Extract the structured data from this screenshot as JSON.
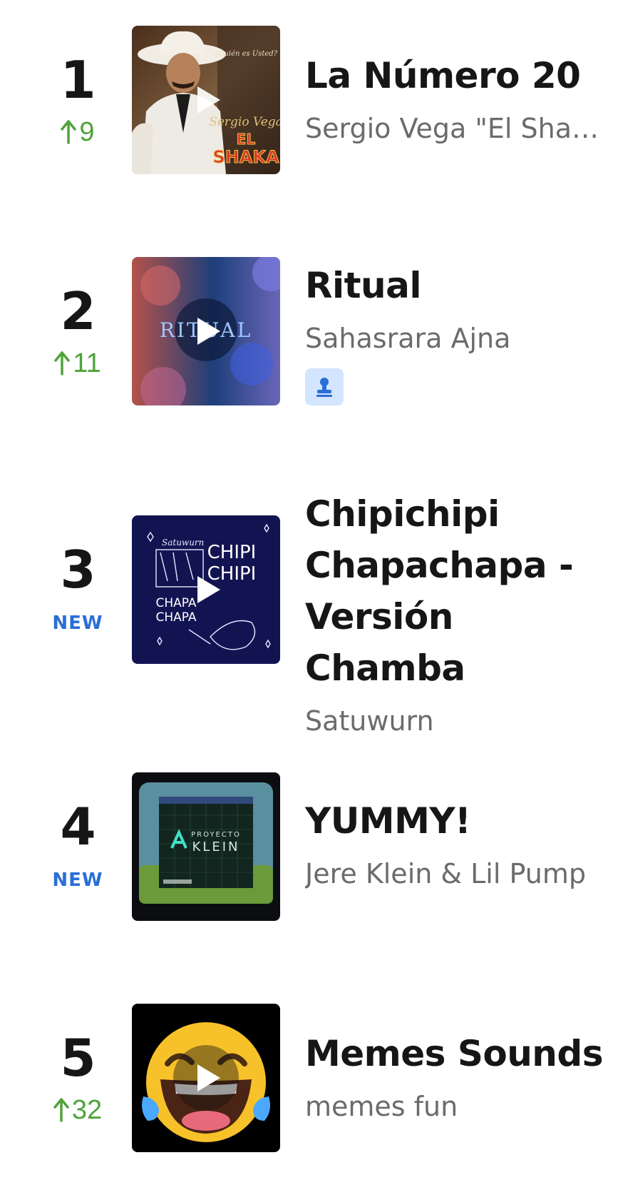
{
  "chart": {
    "entries": [
      {
        "rank": "1",
        "change": "9",
        "change_type": "up",
        "title": "La Número 20",
        "artist": "Sergio Vega \"El Shaka\"",
        "cover_icon": "album-cover-cowboy"
      },
      {
        "rank": "2",
        "change": "11",
        "change_type": "up",
        "title": "Ritual",
        "artist": "Sahasrara Ajna",
        "cover_icon": "album-cover-ritual",
        "badge_icon": "stamp-icon"
      },
      {
        "rank": "3",
        "change": "NEW",
        "change_type": "new",
        "title": "Chipichipi Chapachapa - Versión Chamba",
        "artist": "Satuwurn",
        "cover_icon": "album-cover-chipichipi"
      },
      {
        "rank": "4",
        "change": "NEW",
        "change_type": "new",
        "title": "YUMMY!",
        "artist": "Jere Klein & Lil Pump",
        "cover_icon": "album-cover-proyecto-klein"
      },
      {
        "rank": "5",
        "change": "32",
        "change_type": "up",
        "title": "Memes Sounds",
        "artist": "memes fun",
        "cover_icon": "album-cover-laughing-emoji"
      }
    ]
  },
  "covers": {
    "cover1": {
      "text_top": "¿Quién es Usted?",
      "text_name": "Sergio Vega",
      "text_logo1": "EL",
      "text_logo2": "SHAKA"
    },
    "cover2": {
      "text": "RITUAL"
    },
    "cover3": {
      "text_tag": "Satuwurn",
      "text_a": "CHIPI",
      "text_b": "CHIPI",
      "text_c": "CHAPA",
      "text_d": "CHAPA"
    },
    "cover4": {
      "text_a": "PROYECTO",
      "text_b": "KLEIN"
    }
  },
  "colors": {
    "up": "#4fa33b",
    "new": "#2a6ed8",
    "artist": "#6b6b6b",
    "badge_bg": "#d3e5ff"
  }
}
